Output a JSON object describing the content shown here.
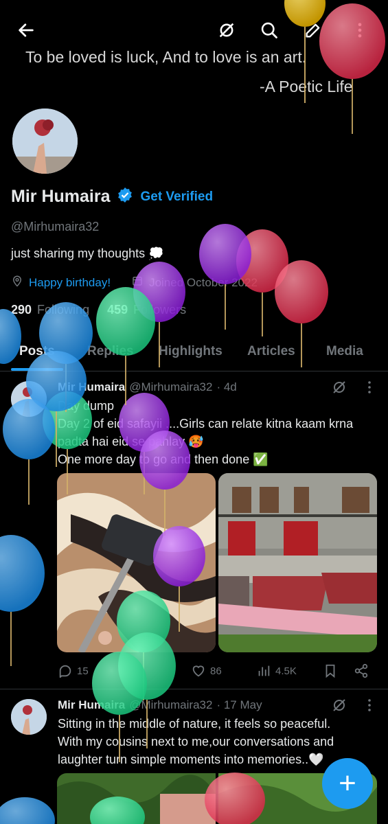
{
  "banner": {
    "quote_line1": "To be loved is luck, And to love is an art.",
    "quote_line2": "-A Poetic Life"
  },
  "topbar": {
    "back": "back-arrow-icon",
    "icons": [
      "grok-icon",
      "search-icon",
      "edit-icon",
      "more-icon"
    ]
  },
  "profile": {
    "name": "Mir Humaira",
    "get_verified": "Get Verified",
    "handle": "@Mirhumaira32",
    "bio": "just sharing my thoughts 💭",
    "birthday": "Happy birthday!",
    "joined": "Joined October 2022",
    "following_count": "290",
    "following_label": "Following",
    "followers_count": "459",
    "followers_label": "Followers"
  },
  "tabs": [
    "Posts",
    "Replies",
    "Highlights",
    "Articles",
    "Media"
  ],
  "tweets": [
    {
      "name": "Mir Humaira",
      "handle": "@Mirhumaira32",
      "time": "· 4d",
      "line1": "Day dump",
      "line2": "Day 2 of eid safayii ....Girls can relate kitna kaam krna",
      "line3": "padta hai eid se pahlay 🥵",
      "line4": "One more day to go and then done ✅",
      "replies": "15",
      "likes": "86",
      "views": "4.5K"
    },
    {
      "name": "Mir Humaira",
      "handle": "@Mirhumaira32",
      "time": "· 17 May",
      "line1": "Sitting in the middle of nature, it feels so peaceful.",
      "line2": "With my cousins next to me,our conversations and",
      "line3": "laughter turn simple moments into memories..🤍"
    }
  ],
  "fab": "+",
  "colors": {
    "accent": "#1d9bf0",
    "background": "#000000",
    "muted": "#71767b"
  }
}
